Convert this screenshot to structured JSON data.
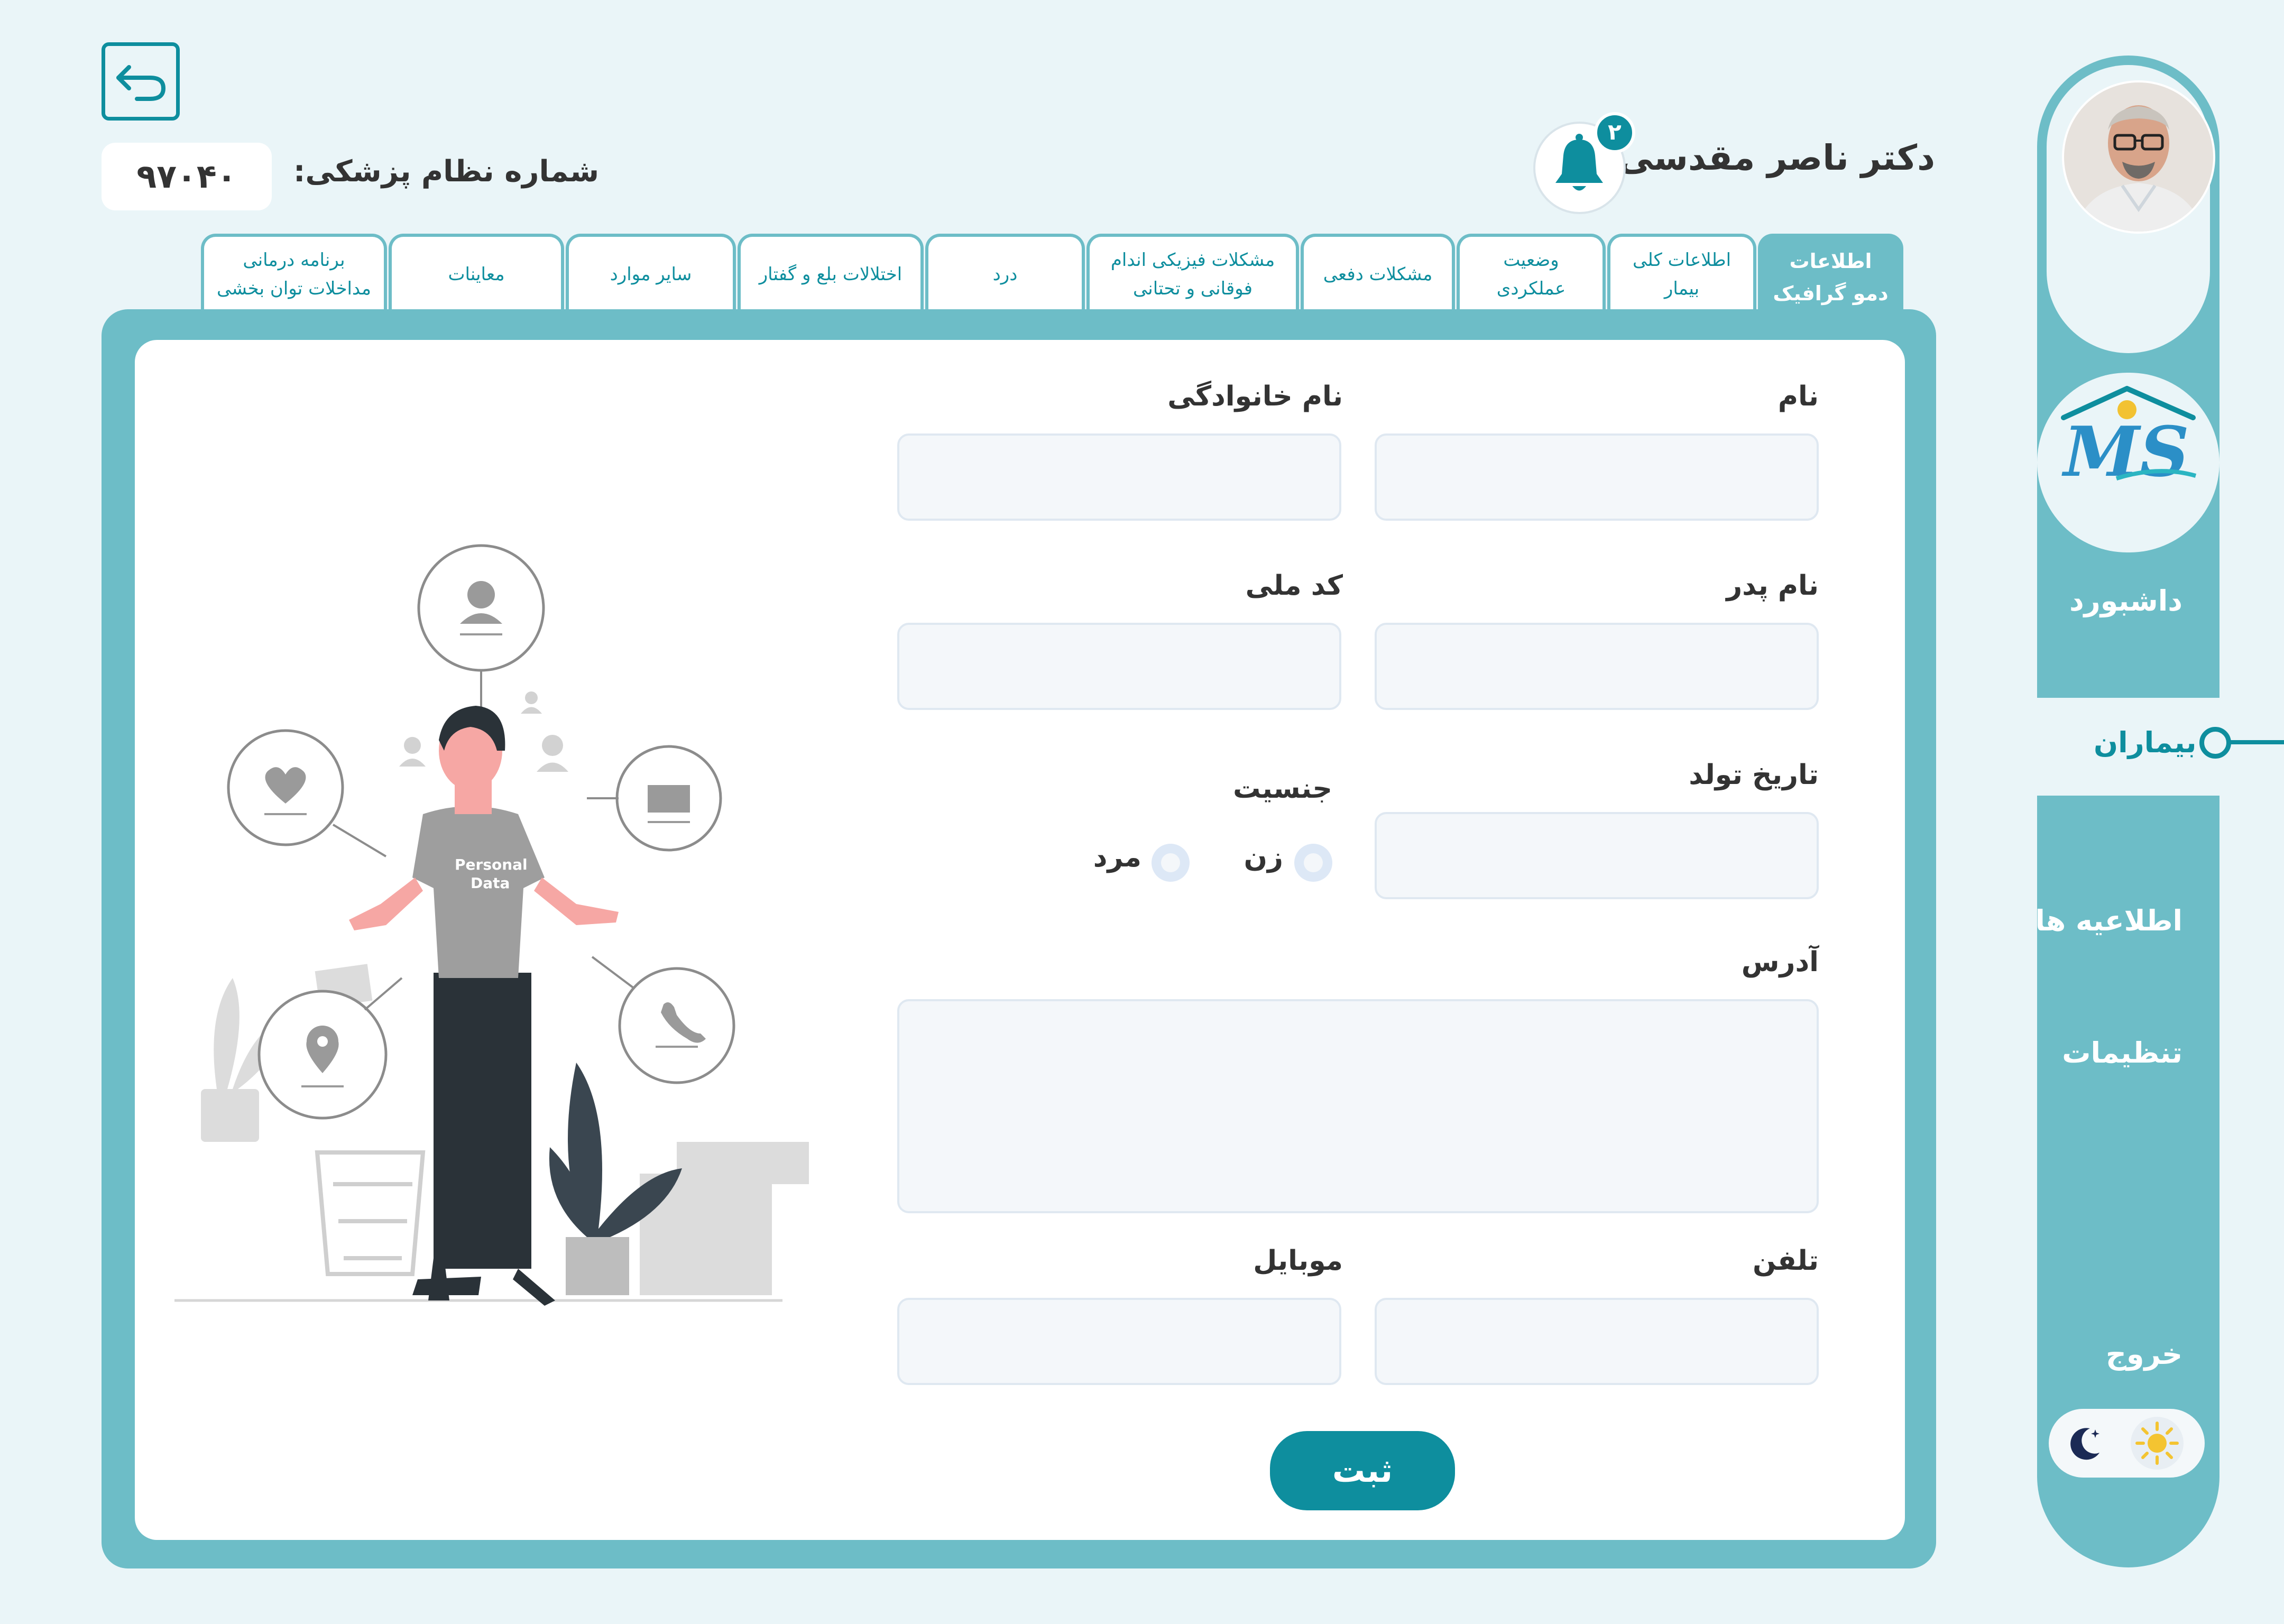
{
  "sidebar": {
    "items": [
      {
        "id": "dashboard",
        "label": "داشبورد"
      },
      {
        "id": "patients",
        "label": "بیماران",
        "active": true
      },
      {
        "id": "notices",
        "label": "اطلاعیه ها"
      },
      {
        "id": "settings",
        "label": "تنظیمات"
      },
      {
        "id": "logout",
        "label": "خروج"
      }
    ],
    "theme_toggle": {
      "dark_icon": "moon-icon",
      "light_icon": "sun-icon"
    },
    "logo_text": "MS"
  },
  "header": {
    "doctor_name": "دکتر ناصر مقدسی",
    "notification_count": "۲",
    "license_label": "شماره نظام پزشکی:",
    "license_number": "۹۷۰۴۰"
  },
  "tabs": [
    {
      "id": "demographic",
      "label_line1": "اطلاعات",
      "label_line2": "دمو گرافیک",
      "active": true
    },
    {
      "id": "general",
      "label_line1": "اطلاعات کلی",
      "label_line2": "بیمار"
    },
    {
      "id": "functional",
      "label_line1": "وضعیت",
      "label_line2": "عملکردی"
    },
    {
      "id": "bowel",
      "label_line1": "مشکلات دفعی",
      "label_line2": ""
    },
    {
      "id": "limbs",
      "label_line1": "مشکلات فیزیکی اندام",
      "label_line2": "فوقانی و تحتانی"
    },
    {
      "id": "pain",
      "label_line1": "درد",
      "label_line2": ""
    },
    {
      "id": "swallow",
      "label_line1": "اختلالات بلع و گفتار",
      "label_line2": ""
    },
    {
      "id": "other",
      "label_line1": "سایر موارد",
      "label_line2": ""
    },
    {
      "id": "exams",
      "label_line1": "معاینات",
      "label_line2": ""
    },
    {
      "id": "plan",
      "label_line1": "برنامه درمانی",
      "label_line2": "مداخلات توان بخشی"
    }
  ],
  "form": {
    "first_name": {
      "label": "نام",
      "value": ""
    },
    "last_name": {
      "label": "نام خانوادگی",
      "value": ""
    },
    "father_name": {
      "label": "نام پدر",
      "value": ""
    },
    "national_code": {
      "label": "کد ملی",
      "value": ""
    },
    "birth_date": {
      "label": "تاریخ تولد",
      "value": ""
    },
    "gender": {
      "label": "جنسیت",
      "options": [
        "زن",
        "مرد"
      ],
      "selected": ""
    },
    "address": {
      "label": "آدرس",
      "value": ""
    },
    "phone": {
      "label": "تلفن",
      "value": ""
    },
    "mobile": {
      "label": "موبایل",
      "value": ""
    },
    "submit_label": "ثبت"
  },
  "illustration": {
    "shirt_text_line1": "Personal",
    "shirt_text_line2": "Data"
  },
  "colors": {
    "accent": "#0e8e9e",
    "panel": "#6dbdc7",
    "background": "#eaf5f8",
    "field_bg": "#f4f7fa",
    "field_border": "#dfe8f1"
  }
}
